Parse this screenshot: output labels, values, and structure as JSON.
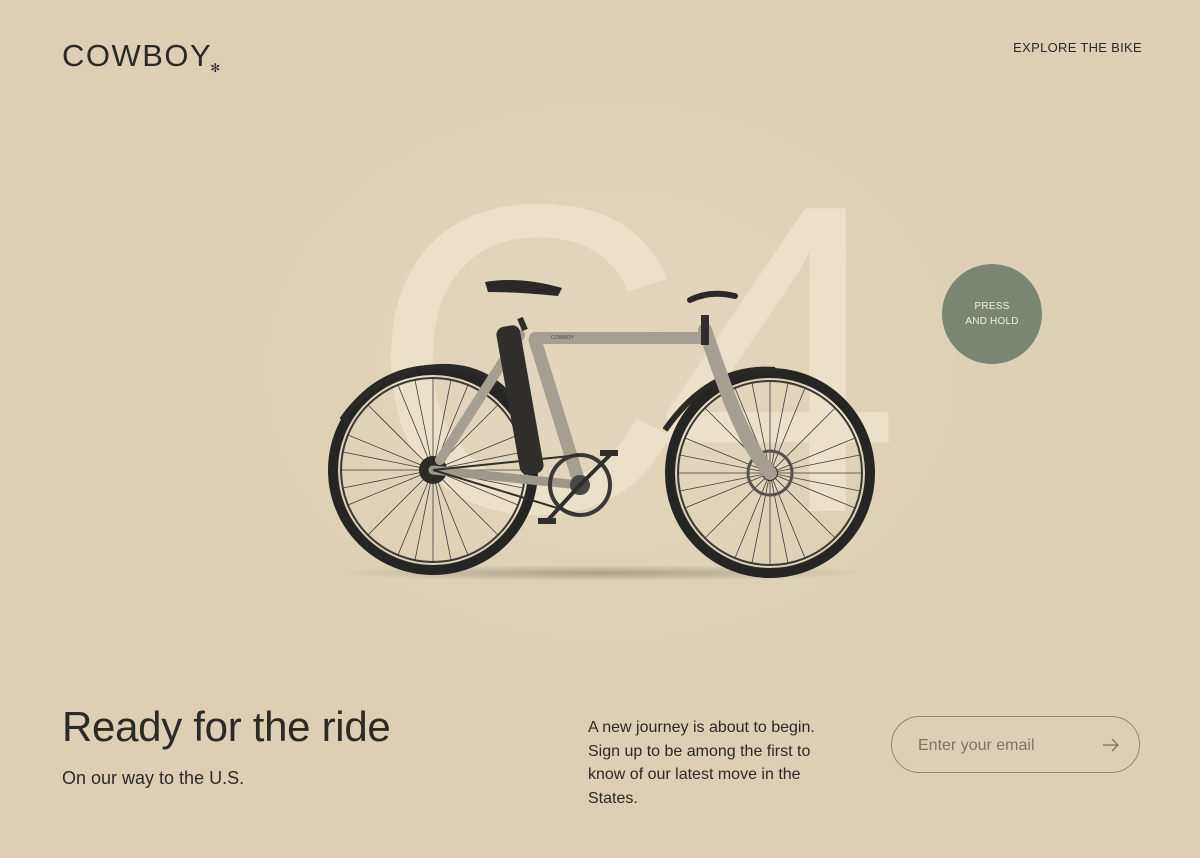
{
  "header": {
    "logo_text": "COWBOY",
    "logo_mark": "✻",
    "nav_link": "EXPLORE THE BIKE"
  },
  "hero": {
    "model_number": "C4",
    "bike_frame_text": "COWBOY",
    "press_hold_line1": "PRESS",
    "press_hold_line2": "AND HOLD",
    "press_hold_color": "#7b8672"
  },
  "footer": {
    "headline": "Ready for the ride",
    "subheadline": "On our way to the U.S.",
    "description": "A new journey is about to begin. Sign up to be among the first to know of our latest move in the States.",
    "email_placeholder": "Enter your email",
    "submit_icon": "arrow-right-icon"
  },
  "colors": {
    "background": "#dccfb3",
    "text": "#2b2a26",
    "numeral": "#ece1c9"
  }
}
